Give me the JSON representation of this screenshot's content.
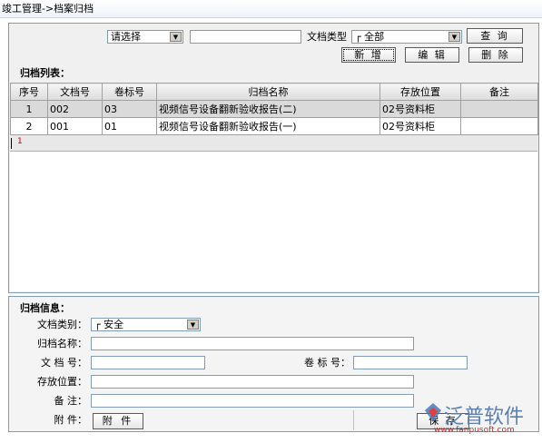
{
  "breadcrumb": "竣工管理->档案归档",
  "filter": {
    "select_value": "请选择",
    "keyword_value": "",
    "doctype_label": "文档类型",
    "doctype_value": "┌ 全部",
    "query_label": "查 询"
  },
  "toolbar": {
    "new_label": "新 增",
    "edit_label": "编 辑",
    "delete_label": "删 除"
  },
  "list": {
    "title": "归档列表：",
    "columns": [
      "序号",
      "文档号",
      "卷标号",
      "归档名称",
      "存放位置",
      "备注"
    ],
    "rows": [
      [
        "1",
        "002",
        "03",
        "视频信号设备翻新验收报告(二)",
        "02号资料柜",
        ""
      ],
      [
        "2",
        "001",
        "01",
        "视频信号设备翻新验收报告(一)",
        "02号资料柜",
        ""
      ]
    ],
    "new_row_marker": "1"
  },
  "form": {
    "title": "归档信息：",
    "category_label": "文档类别：",
    "category_value": "┌ 安全",
    "name_label": "归档名称：",
    "name_value": "",
    "docno_label": "文 档 号：",
    "docno_value": "",
    "volno_label": "卷 标 号：",
    "volno_value": "",
    "location_label": "存放位置：",
    "location_value": "",
    "remark_label": "备    注：",
    "remark_value": "",
    "attach_label": "附    件：",
    "attach_button": "附 件",
    "save_button": "保 存"
  },
  "watermark": {
    "brand": "泛普软件",
    "url": "www.fanpusoft.com"
  },
  "colors": {
    "border": "#7f9db9",
    "selected_row": "#dadada",
    "marker": "#cc0000"
  }
}
